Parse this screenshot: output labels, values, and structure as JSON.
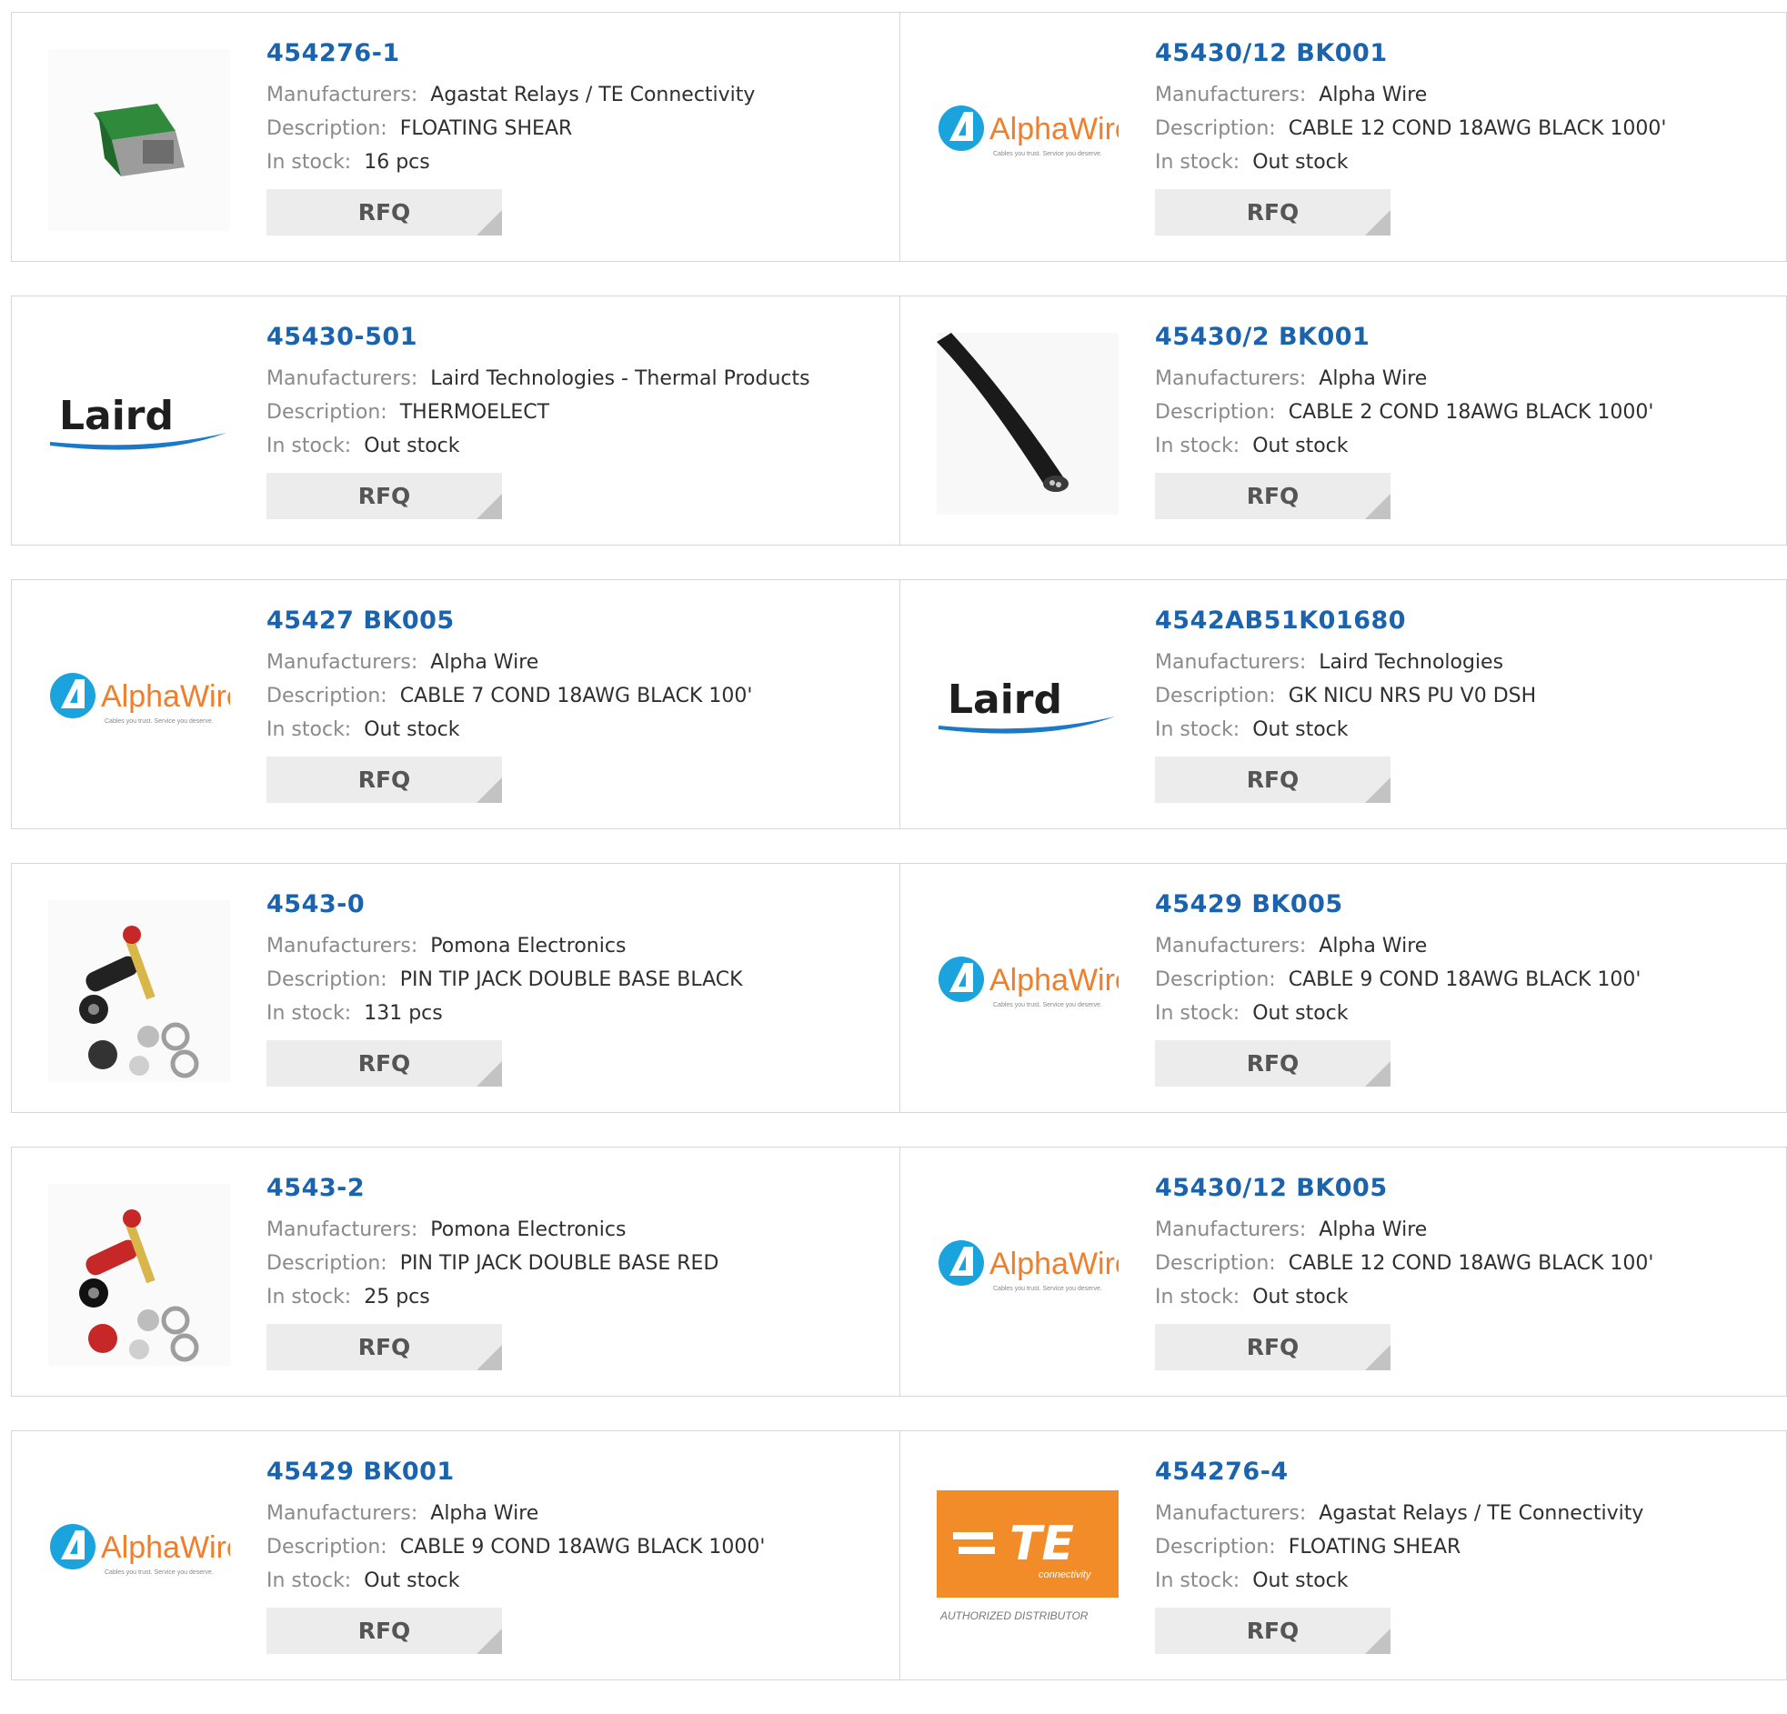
{
  "labels": {
    "manufacturers": "Manufacturers:",
    "description": "Description:",
    "stock": "In stock:",
    "rfq": "RFQ"
  },
  "colors": {
    "part_number": "#1b63ad",
    "label": "#8a8a8a",
    "value": "#2f2f2f",
    "rfq_bg": "#ececec",
    "border": "#d6d6d6",
    "alpha_wire_blue": "#1aa3dc",
    "laird_blue": "#1a7ac8",
    "te_orange": "#f28c28"
  },
  "logos": {
    "alphawire": {
      "name": "AlphaWire",
      "tagline": "Cables you trust. Service you deserve."
    },
    "laird": {
      "name": "Laird"
    },
    "te": {
      "name": "TE",
      "sub": "connectivity",
      "caption": "AUTHORIZED DISTRIBUTOR"
    }
  },
  "products": [
    {
      "part_number": "454276-1",
      "manufacturer": "Agastat Relays / TE Connectivity",
      "description": "FLOATING SHEAR",
      "stock": "16 pcs",
      "image": "green-relay-photo"
    },
    {
      "part_number": "45430/12 BK001",
      "manufacturer": "Alpha Wire",
      "description": "CABLE 12 COND 18AWG BLACK 1000'",
      "stock": "Out stock",
      "image": "alphawire-logo"
    },
    {
      "part_number": "45430-501",
      "manufacturer": "Laird Technologies - Thermal Products",
      "description": "THERMOELECT",
      "stock": "Out stock",
      "image": "laird-logo"
    },
    {
      "part_number": "45430/2 BK001",
      "manufacturer": "Alpha Wire",
      "description": "CABLE 2 COND 18AWG BLACK 1000'",
      "stock": "Out stock",
      "image": "black-cable-photo"
    },
    {
      "part_number": "45427 BK005",
      "manufacturer": "Alpha Wire",
      "description": "CABLE 7 COND 18AWG BLACK 100'",
      "stock": "Out stock",
      "image": "alphawire-logo"
    },
    {
      "part_number": "4542AB51K01680",
      "manufacturer": "Laird Technologies",
      "description": "GK NICU NRS PU V0 DSH",
      "stock": "Out stock",
      "image": "laird-logo"
    },
    {
      "part_number": "4543-0",
      "manufacturer": "Pomona Electronics",
      "description": "PIN TIP JACK DOUBLE BASE BLACK",
      "stock": "131 pcs",
      "image": "black-tip-jack-photo"
    },
    {
      "part_number": "45429 BK005",
      "manufacturer": "Alpha Wire",
      "description": "CABLE 9 COND 18AWG BLACK 100'",
      "stock": "Out stock",
      "image": "alphawire-logo"
    },
    {
      "part_number": "4543-2",
      "manufacturer": "Pomona Electronics",
      "description": "PIN TIP JACK DOUBLE BASE RED",
      "stock": "25 pcs",
      "image": "red-tip-jack-photo"
    },
    {
      "part_number": "45430/12 BK005",
      "manufacturer": "Alpha Wire",
      "description": "CABLE 12 COND 18AWG BLACK 100'",
      "stock": "Out stock",
      "image": "alphawire-logo"
    },
    {
      "part_number": "45429 BK001",
      "manufacturer": "Alpha Wire",
      "description": "CABLE 9 COND 18AWG BLACK 1000'",
      "stock": "Out stock",
      "image": "alphawire-logo"
    },
    {
      "part_number": "454276-4",
      "manufacturer": "Agastat Relays / TE Connectivity",
      "description": "FLOATING SHEAR",
      "stock": "Out stock",
      "image": "te-logo"
    }
  ]
}
